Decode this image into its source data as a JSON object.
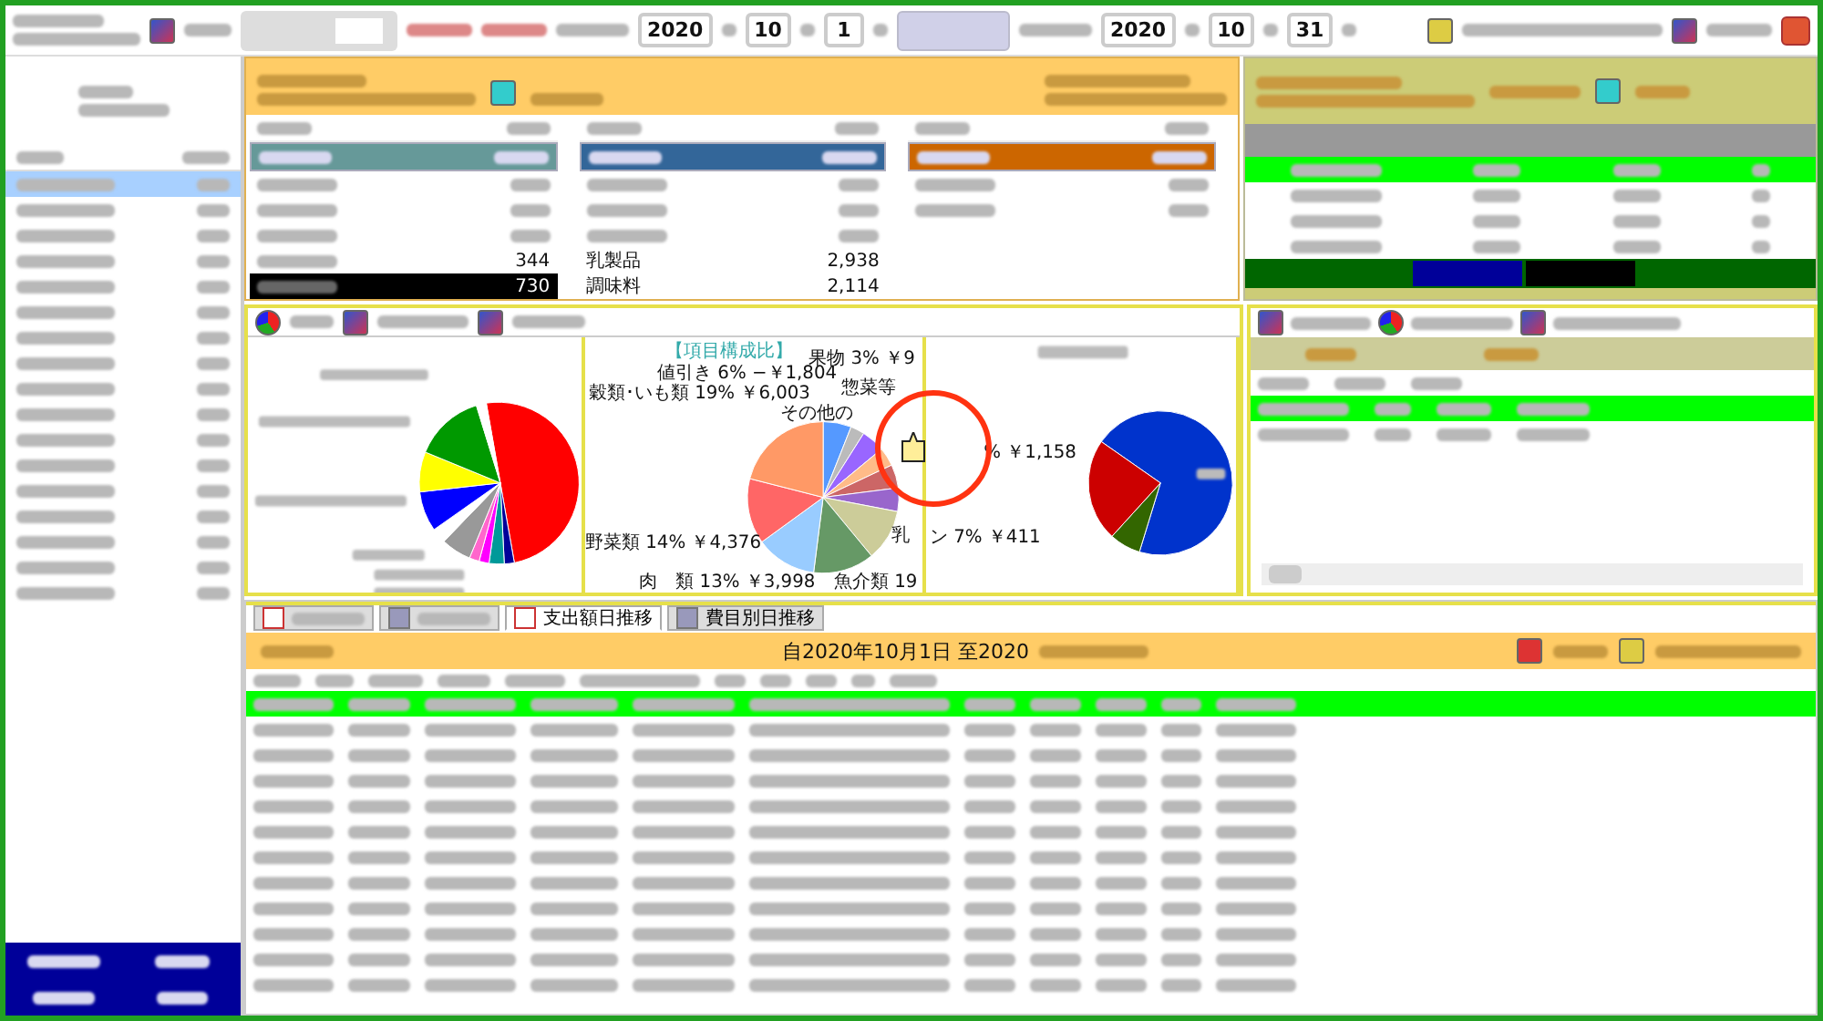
{
  "period": {
    "start": {
      "year": "2020",
      "month": "10",
      "day": "1"
    },
    "end": {
      "year": "2020",
      "month": "10",
      "day": "31"
    }
  },
  "sidebar": {
    "rows": [
      {
        "selected": true
      },
      {
        "selected": false
      },
      {
        "selected": false
      },
      {
        "selected": false
      },
      {
        "selected": false
      },
      {
        "selected": false
      },
      {
        "selected": false
      },
      {
        "selected": false
      },
      {
        "selected": false
      },
      {
        "selected": false
      },
      {
        "selected": false
      },
      {
        "selected": false
      },
      {
        "selected": false
      },
      {
        "selected": false
      },
      {
        "selected": false
      },
      {
        "selected": false
      },
      {
        "selected": false
      }
    ]
  },
  "summary_columns": [
    {
      "color": "#669999",
      "rows": [
        {
          "selected": true
        },
        {
          "selected": false
        },
        {
          "selected": false
        },
        {
          "selected": false
        },
        {
          "selected": false,
          "value": "344"
        }
      ],
      "total": {
        "value": "730"
      }
    },
    {
      "color": "#336699",
      "rows": [
        {
          "selected": true
        },
        {
          "selected": false
        },
        {
          "selected": false
        },
        {
          "selected": false
        },
        {
          "selected": false,
          "label": "乳製品",
          "value": "2,938"
        },
        {
          "selected": false,
          "label": "調味料",
          "value": "2,114"
        }
      ]
    },
    {
      "color": "#cc6600",
      "rows": [
        {
          "selected": true
        },
        {
          "selected": false
        },
        {
          "selected": false
        }
      ]
    }
  ],
  "group_table": {
    "rows": [
      {
        "selected": true
      },
      {
        "selected": false
      },
      {
        "selected": false
      },
      {
        "selected": false
      }
    ]
  },
  "pie_chart": {
    "title": "【項目構成比】",
    "labels": [
      "果物 3% ￥9",
      "値引き 6% −￥1,804",
      "惣菜等",
      "穀類･いも類 19% ￥6,003",
      "その他の",
      "野菜類 14% ￥4,376",
      "乳",
      "肉　類 13% ￥3,998",
      "魚介類 19"
    ]
  },
  "pie_chart_2": {
    "labels": [
      "% ￥1,158",
      "ン 7% ￥411"
    ]
  },
  "store_list": {
    "rows": [
      {
        "selected": true
      },
      {
        "selected": false
      }
    ]
  },
  "bottom_tabs": [
    {
      "selected": false
    },
    {
      "selected": false
    },
    {
      "label": "支出額日推移",
      "selected": true
    },
    {
      "label": "費目別日推移",
      "selected": false
    }
  ],
  "detail": {
    "title": "自2020年10月1日 至2020",
    "rows": [
      {
        "selected": true
      },
      {
        "selected": false
      },
      {
        "selected": false
      },
      {
        "selected": false
      },
      {
        "selected": false
      },
      {
        "selected": false
      },
      {
        "selected": false
      },
      {
        "selected": false
      },
      {
        "selected": false
      },
      {
        "selected": false
      },
      {
        "selected": false
      },
      {
        "selected": false
      }
    ]
  }
}
